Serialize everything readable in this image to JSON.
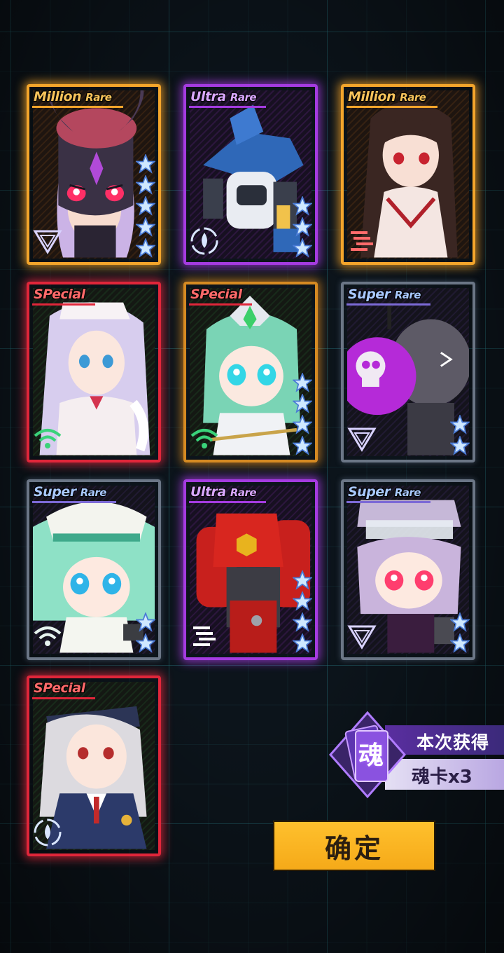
{
  "cards": [
    {
      "id": "c1",
      "rarity": "million",
      "label_main": "Million",
      "label_sub": "Rare",
      "stars": 5,
      "class_icon": "triangle-class-icon",
      "subject": "horned-demon-helmet-girl"
    },
    {
      "id": "c2",
      "rarity": "ultra",
      "label_main": "Ultra",
      "label_sub": "Rare",
      "stars": 3,
      "class_icon": "drop-class-icon",
      "subject": "blue-white-mecha"
    },
    {
      "id": "c3",
      "rarity": "million",
      "label_main": "Million",
      "label_sub": "Rare",
      "stars": 0,
      "class_icon": "claw-class-icon",
      "subject": "black-haired-girl"
    },
    {
      "id": "c4",
      "rarity": "special",
      "label_main": "SPecial",
      "label_sub": "",
      "stars": 0,
      "class_icon": "wifi-class-icon",
      "subject": "nurse-girl"
    },
    {
      "id": "c5",
      "rarity": "special-gold",
      "label_main": "SPecial",
      "label_sub": "",
      "stars": 4,
      "class_icon": "wifi-class-icon",
      "subject": "green-haired-chibi-knight"
    },
    {
      "id": "c6",
      "rarity": "super",
      "label_main": "Super",
      "label_sub": "Rare",
      "stars": 2,
      "class_icon": "triangle-class-icon",
      "subject": "skull-bomb-robot"
    },
    {
      "id": "c7",
      "rarity": "super",
      "label_main": "Super",
      "label_sub": "Rare",
      "stars": 2,
      "class_icon": "wifi-class-icon",
      "subject": "green-haired-chibi-officer"
    },
    {
      "id": "c8",
      "rarity": "ultra",
      "label_main": "Ultra",
      "label_sub": "Rare",
      "stars": 4,
      "class_icon": "claw-class-icon",
      "subject": "red-mecha"
    },
    {
      "id": "c9",
      "rarity": "super",
      "label_main": "Super",
      "label_sub": "Rare",
      "stars": 2,
      "class_icon": "triangle-class-icon",
      "subject": "visor-cap-chibi-girl"
    },
    {
      "id": "c10",
      "rarity": "special",
      "label_main": "SPecial",
      "label_sub": "",
      "stars": 0,
      "class_icon": "drop-class-icon",
      "subject": "police-girl"
    }
  ],
  "soul_reward": {
    "icon_char": "魂",
    "title": "本次获得",
    "count_text": "魂卡x3"
  },
  "confirm_button": {
    "label": "确定"
  },
  "colors": {
    "million": "#f3a52b",
    "ultra": "#a43be0",
    "special": "#e0263a",
    "super": "#6b7686",
    "button": "#ffb720",
    "star": "#cfe8ff"
  }
}
